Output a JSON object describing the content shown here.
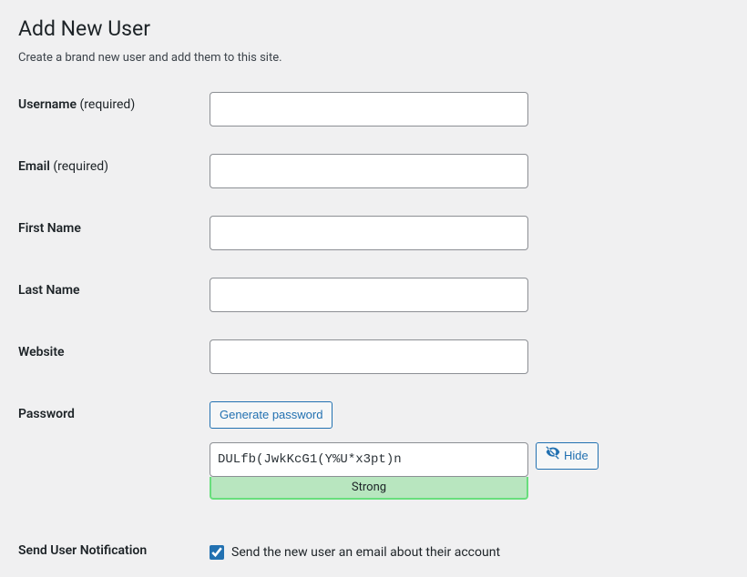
{
  "header": {
    "title": "Add New User",
    "subtitle": "Create a brand new user and add them to this site."
  },
  "fields": {
    "username": {
      "label": "Username",
      "required_text": "(required)",
      "value": ""
    },
    "email": {
      "label": "Email",
      "required_text": "(required)",
      "value": ""
    },
    "first_name": {
      "label": "First Name",
      "value": ""
    },
    "last_name": {
      "label": "Last Name",
      "value": ""
    },
    "website": {
      "label": "Website",
      "value": ""
    },
    "password": {
      "label": "Password",
      "generate_button": "Generate password",
      "value": "DULfb(JwkKcG1(Y%U*x3pt)n",
      "strength": "Strong",
      "hide_button": "Hide"
    },
    "notification": {
      "label": "Send User Notification",
      "checkbox_label": "Send the new user an email about their account",
      "checked": true
    }
  }
}
